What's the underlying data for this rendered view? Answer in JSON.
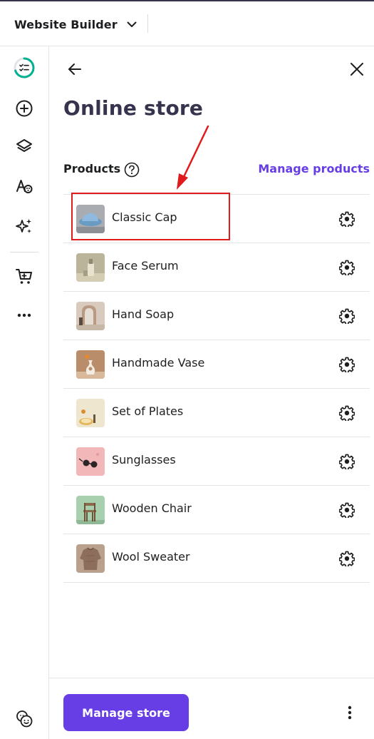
{
  "topbar": {
    "app_title": "Website Builder"
  },
  "rail": {
    "items": [
      {
        "icon": "progress-checklist-icon"
      },
      {
        "icon": "add-circle-icon"
      },
      {
        "icon": "layers-icon"
      },
      {
        "icon": "styles-icon"
      },
      {
        "icon": "ai-sparkle-icon"
      },
      {
        "icon": "cart-icon"
      },
      {
        "icon": "more-horizontal-icon"
      }
    ],
    "bottom_icon": "help-support-icon"
  },
  "panel": {
    "title": "Online store",
    "products_label": "Products",
    "manage_products_label": "Manage products"
  },
  "products": [
    {
      "name": "Classic Cap"
    },
    {
      "name": "Face Serum"
    },
    {
      "name": "Hand Soap"
    },
    {
      "name": "Handmade Vase"
    },
    {
      "name": "Set of Plates"
    },
    {
      "name": "Sunglasses"
    },
    {
      "name": "Wooden Chair"
    },
    {
      "name": "Wool Sweater"
    }
  ],
  "footer": {
    "manage_store_label": "Manage store"
  },
  "colors": {
    "accent": "#673de6",
    "annotation": "#e01b1b",
    "text_dark": "#1d1e20",
    "title": "#36344d"
  }
}
